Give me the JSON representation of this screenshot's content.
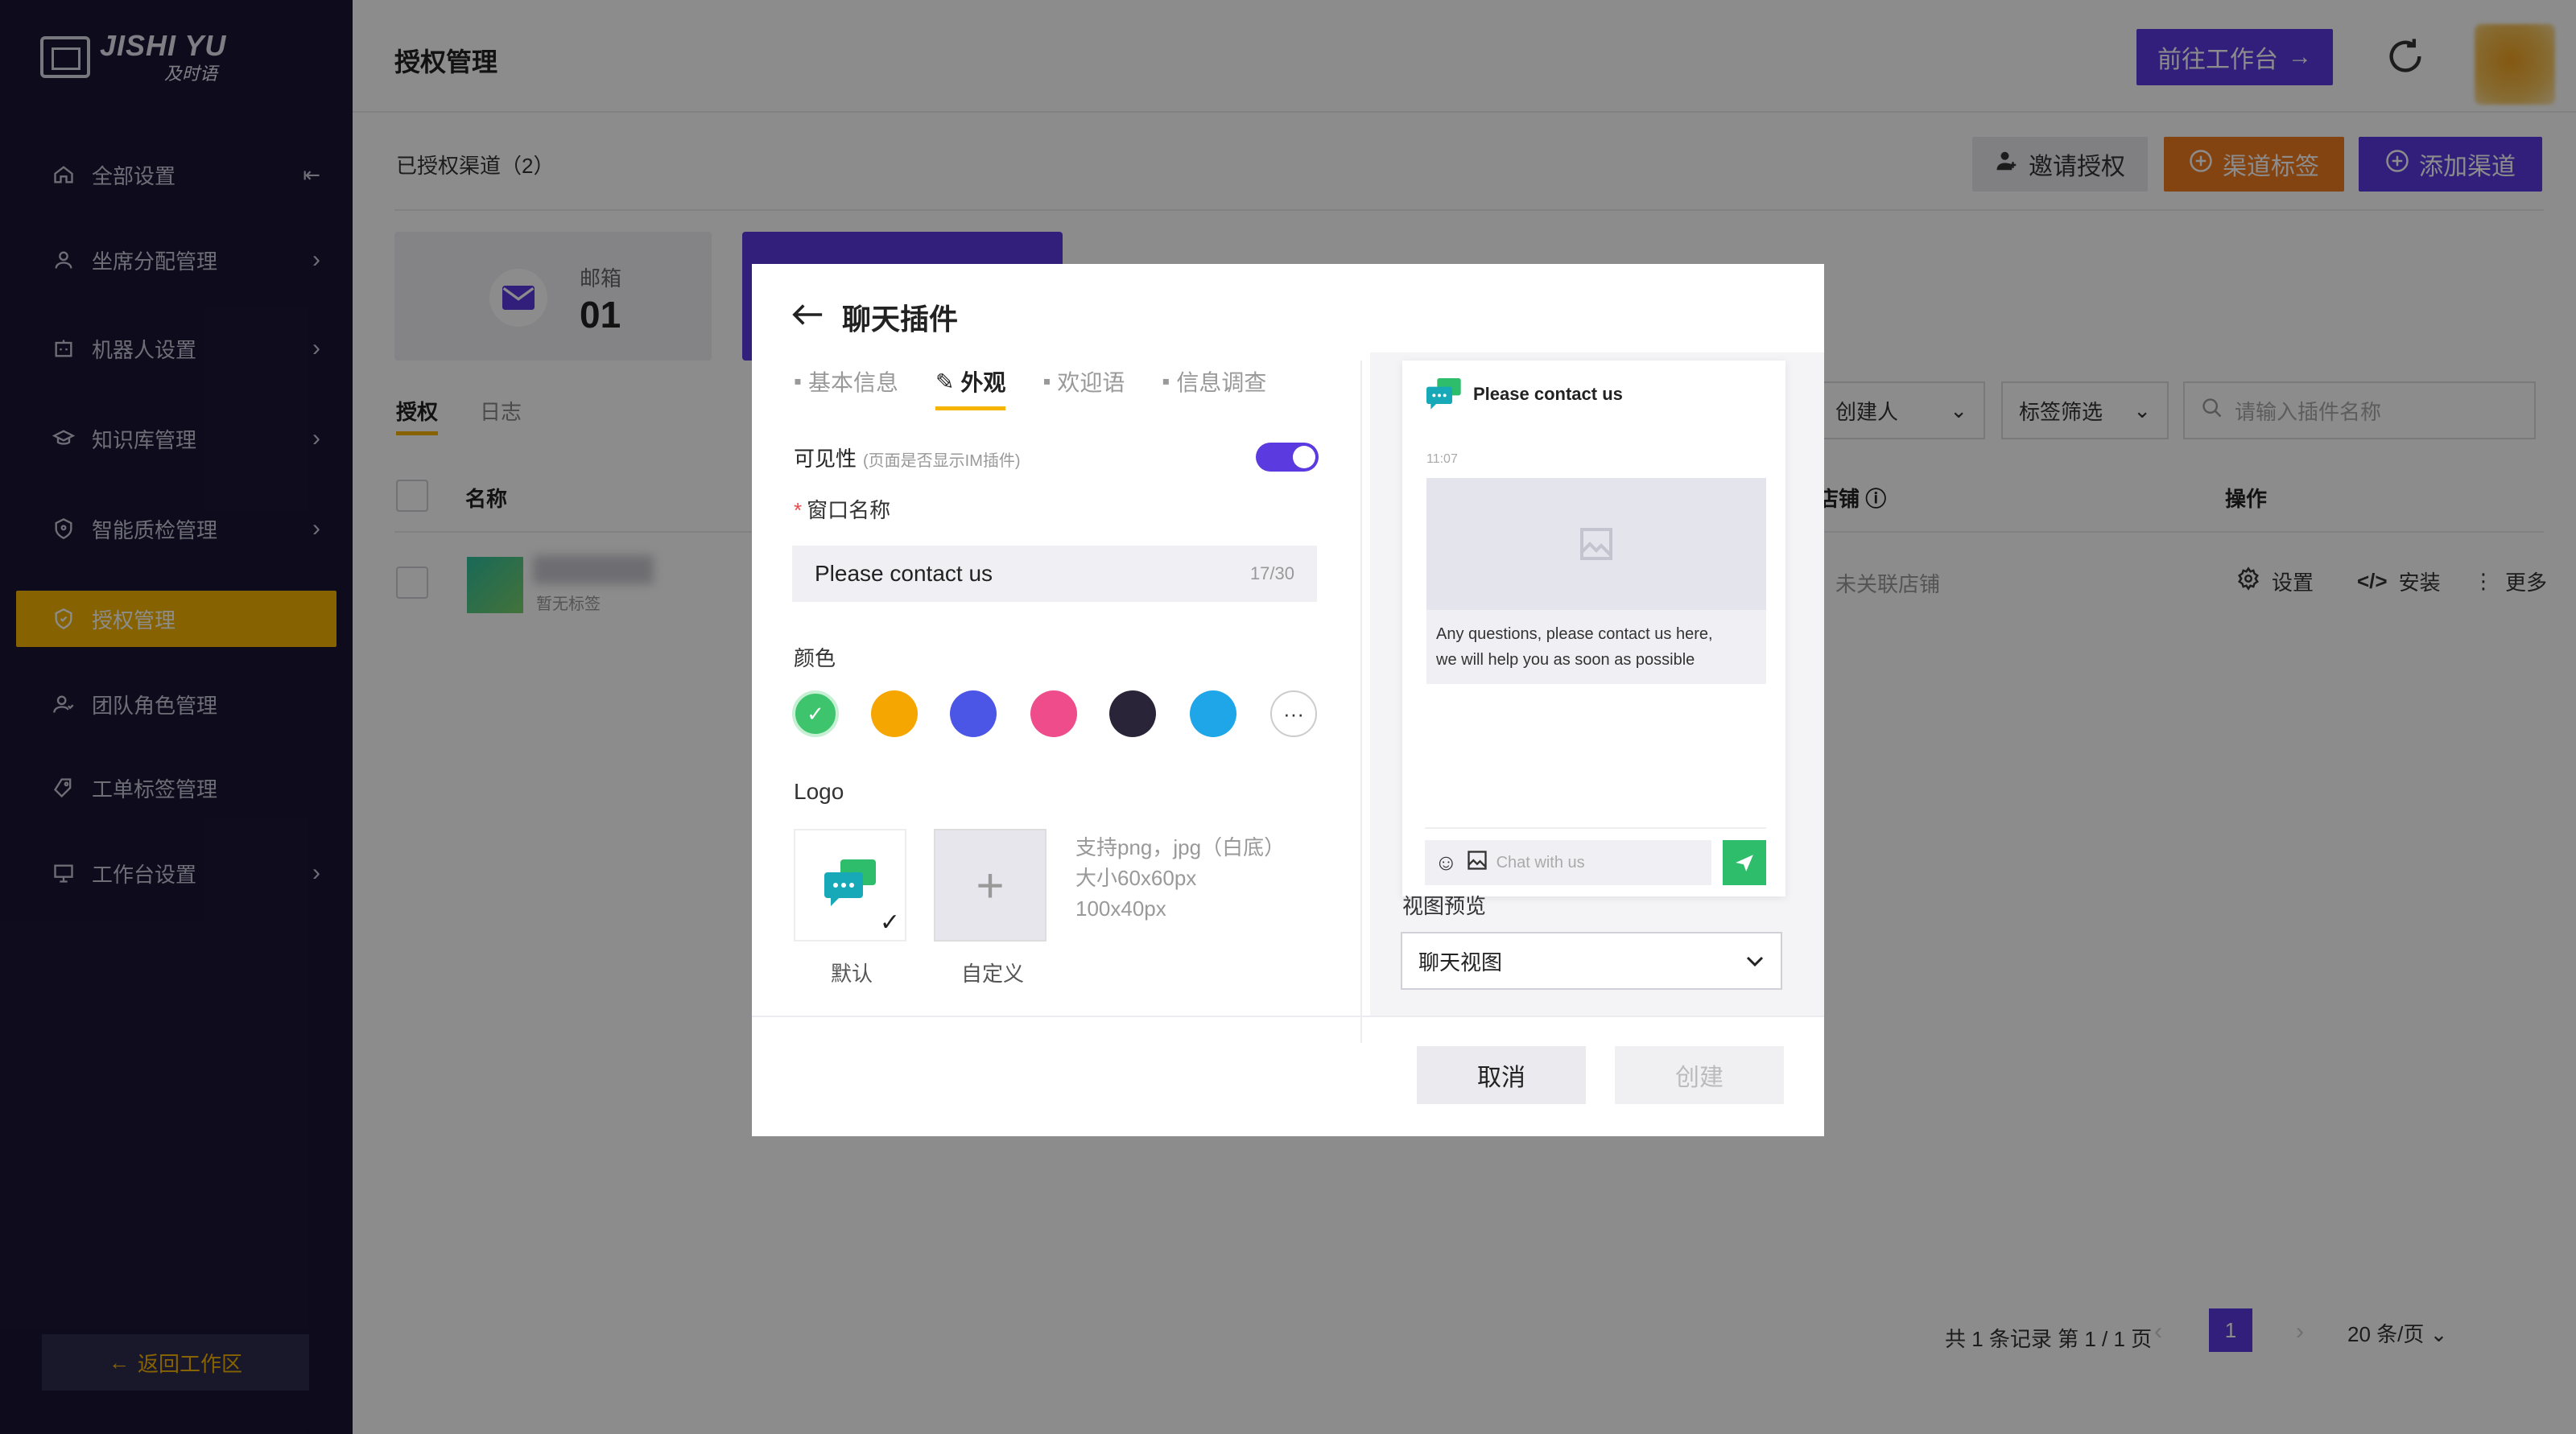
{
  "brand": {
    "name_en": "JISHI YU",
    "name_cn": "及时语"
  },
  "sidebar": {
    "items": [
      {
        "label": "全部设置",
        "icon": "home-icon"
      },
      {
        "label": "坐席分配管理",
        "icon": "user-icon"
      },
      {
        "label": "机器人设置",
        "icon": "robot-icon"
      },
      {
        "label": "知识库管理",
        "icon": "book-icon"
      },
      {
        "label": "智能质检管理",
        "icon": "shield-icon"
      },
      {
        "label": "授权管理",
        "icon": "shield-check-icon",
        "active": true
      },
      {
        "label": "团队角色管理",
        "icon": "team-icon"
      },
      {
        "label": "工单标签管理",
        "icon": "tag-icon"
      },
      {
        "label": "工作台设置",
        "icon": "monitor-icon"
      }
    ],
    "back_label": "返回工作区"
  },
  "header": {
    "title": "授权管理",
    "goto_label": "前往工作台"
  },
  "toolbar": {
    "authorized_count": "已授权渠道（2）",
    "invite": "邀请授权",
    "channel_tag": "渠道标签",
    "add_channel": "添加渠道"
  },
  "cards": {
    "mail_label": "邮箱",
    "mail_count": "01"
  },
  "subtabs": {
    "auth": "授权",
    "log": "日志"
  },
  "filters": {
    "creator": "创建人",
    "tag_filter": "标签筛选",
    "search_placeholder": "请输入插件名称"
  },
  "table": {
    "columns": {
      "name": "名称",
      "shop": "店铺",
      "actions": "操作"
    },
    "row": {
      "tag": "暂无标签",
      "shop": "未关联店铺",
      "settings": "设置",
      "install": "安装",
      "more": "更多"
    }
  },
  "pagination": {
    "summary": "共 1 条记录 第 1 / 1 页",
    "current": "1",
    "page_size": "20 条/页"
  },
  "modal": {
    "title": "聊天插件",
    "tabs": [
      "基本信息",
      "外观",
      "欢迎语",
      "信息调查"
    ],
    "active_tab": "外观",
    "visibility_label": "可见性",
    "visibility_hint": "(页面是否显示IM插件)",
    "visibility_on": true,
    "window_name_label": "窗口名称",
    "window_name_value": "Please contact us",
    "window_name_count": "17/30",
    "color_label": "颜色",
    "colors": [
      "#3ec46d",
      "#f5a600",
      "#4b55e6",
      "#ef4c8c",
      "#2a2438",
      "#1fa6e8"
    ],
    "logo_label": "Logo",
    "logo_default": "默认",
    "logo_custom": "自定义",
    "logo_hint_1": "支持png，jpg（白底）",
    "logo_hint_2": "大小60x60px",
    "logo_hint_3": "100x40px",
    "cancel": "取消",
    "create": "创建"
  },
  "preview": {
    "title": "Please contact us",
    "time": "11:07",
    "message_1": "Any questions, please contact us here,",
    "message_2": "we will help you as soon as possible",
    "input_placeholder": "Chat with us",
    "view_label": "视图预览",
    "view_value": "聊天视图"
  }
}
